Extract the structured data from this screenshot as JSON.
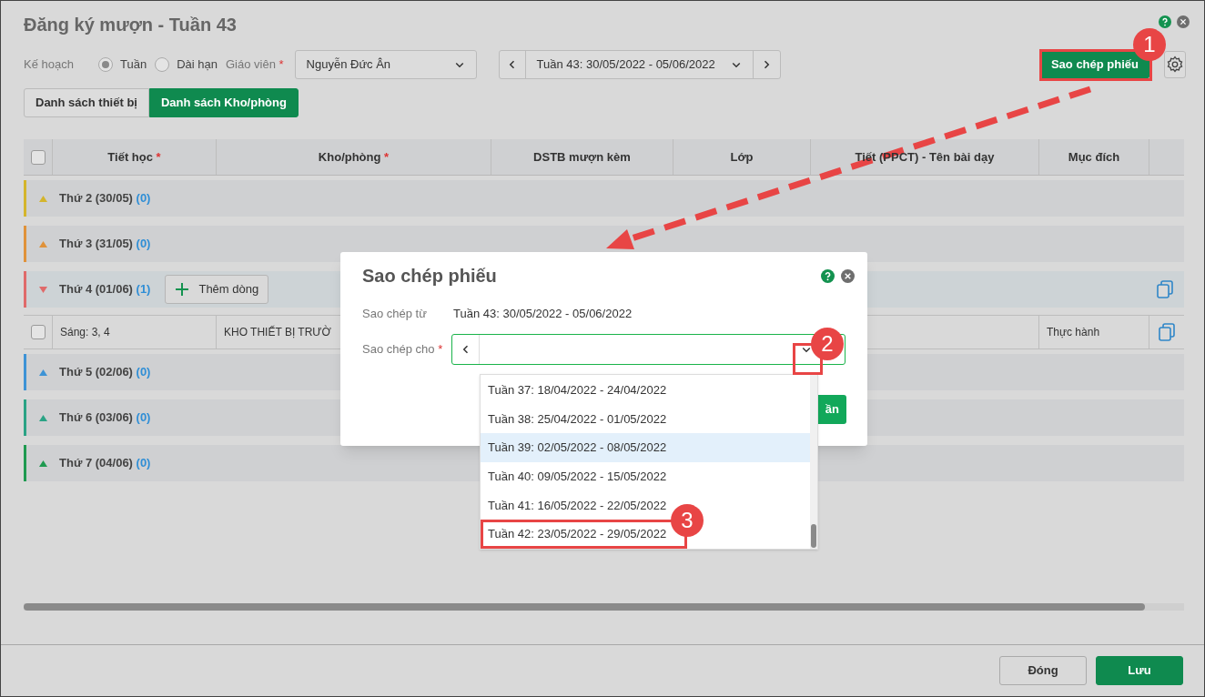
{
  "window": {
    "title": "Đăng ký mượn - Tuần 43"
  },
  "filters": {
    "plan_label": "Kế hoạch",
    "plan_options": [
      {
        "label": "Tuần",
        "selected": true
      },
      {
        "label": "Dài hạn",
        "selected": false
      }
    ],
    "teacher_label": "Giáo viên",
    "teacher_required_mark": "*",
    "teacher_value": "Nguyễn Đức Ân",
    "week_value": "Tuần 43: 30/05/2022 - 05/06/2022",
    "copy_button": "Sao chép phiếu"
  },
  "tabs": [
    {
      "label": "Danh sách thiết bị",
      "selected": false
    },
    {
      "label": "Danh sách Kho/phòng",
      "selected": true
    }
  ],
  "table": {
    "select_all_checked": false,
    "columns": [
      {
        "label": "Tiết học",
        "required_mark": "*"
      },
      {
        "label": "Kho/phòng",
        "required_mark": "*"
      },
      {
        "label": "DSTB mượn kèm"
      },
      {
        "label": "Lớp"
      },
      {
        "label": "Tiết (PPCT) - Tên bài dạy"
      },
      {
        "label": "Mục đích"
      }
    ],
    "groups": [
      {
        "label": "Thứ 2 (30/05)",
        "count": "(0)",
        "color": "#d4b52c",
        "expanded": false
      },
      {
        "label": "Thứ 3 (31/05)",
        "count": "(0)",
        "color": "#e0923a",
        "expanded": false
      },
      {
        "label": "Thứ 4 (01/06)",
        "count": "(1)",
        "color": "#e06a6a",
        "expanded": true,
        "add_button": "Thêm dòng",
        "rows": [
          {
            "checked": false,
            "tiet_hoc": "Sáng: 3, 4",
            "kho_phong": "KHO THIẾT BỊ TRƯỜ",
            "muc_dich": "Thực hành"
          }
        ]
      },
      {
        "label": "Thứ 5 (02/06)",
        "count": "(0)",
        "color": "#3d93d6",
        "expanded": false
      },
      {
        "label": "Thứ 6 (03/06)",
        "count": "(0)",
        "color": "#2aa385",
        "expanded": false
      },
      {
        "label": "Thứ 7 (04/06)",
        "count": "(0)",
        "color": "#1f9a50",
        "expanded": false
      }
    ]
  },
  "footer": {
    "buttons": [
      {
        "label": "Đóng",
        "kind": "secondary"
      },
      {
        "label": "Lưu",
        "kind": "primary"
      }
    ]
  },
  "modal": {
    "title": "Sao chép phiếu",
    "from_label": "Sao chép từ",
    "from_value": "Tuần 43: 30/05/2022 - 05/06/2022",
    "to_label": "Sao chép cho",
    "to_required_mark": "*",
    "confirm_button_visible": "ần",
    "options": [
      {
        "label": "Tuần 37: 18/04/2022 - 24/04/2022",
        "selected": false
      },
      {
        "label": "Tuần 38: 25/04/2022 - 01/05/2022",
        "selected": false
      },
      {
        "label": "Tuần 39: 02/05/2022 - 08/05/2022",
        "selected": true
      },
      {
        "label": "Tuần 40: 09/05/2022 - 15/05/2022",
        "selected": false
      },
      {
        "label": "Tuần 41: 16/05/2022 - 22/05/2022",
        "selected": false
      },
      {
        "label": "Tuần 42: 23/05/2022 - 29/05/2022",
        "selected": false,
        "annotated": true
      }
    ]
  },
  "annotations": [
    {
      "number": "1"
    },
    {
      "number": "2"
    },
    {
      "number": "3"
    }
  ]
}
